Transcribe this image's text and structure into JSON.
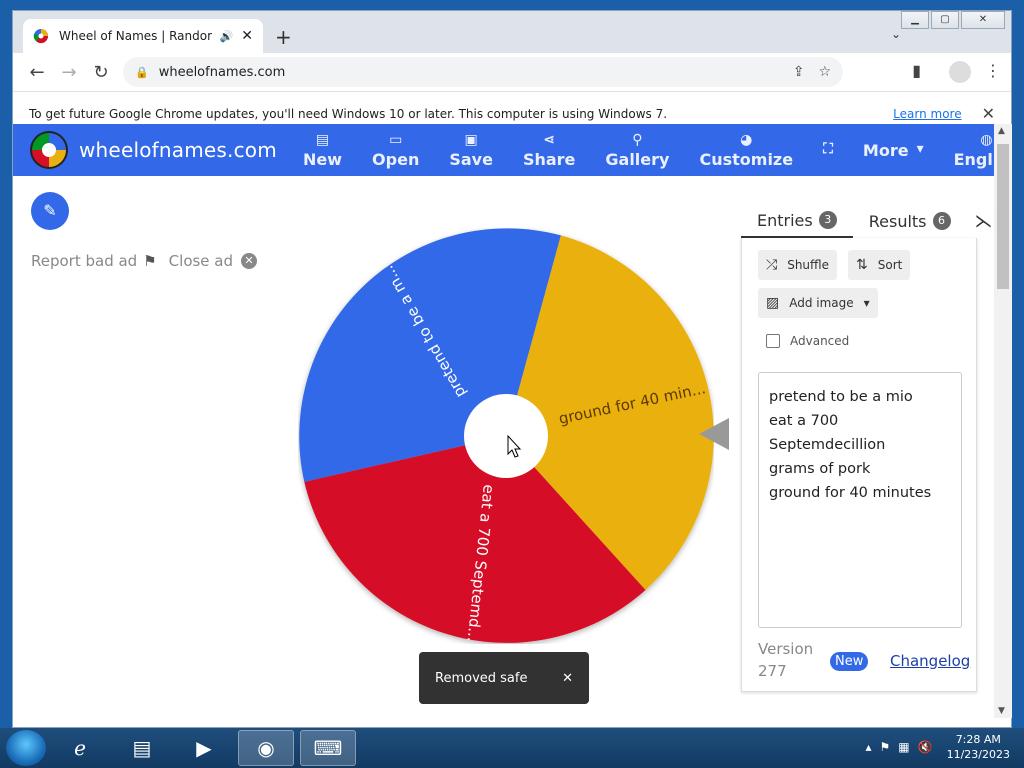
{
  "browser": {
    "tab_title": "Wheel of Names | Random n",
    "url": "wheelofnames.com",
    "infobar_text": "To get future Google Chrome updates, you'll need Windows 10 or later. This computer is using Windows 7.",
    "infobar_link": "Learn more"
  },
  "app": {
    "brand": "wheelofnames.com",
    "menu": [
      {
        "label": "New",
        "icon": "file-icon"
      },
      {
        "label": "Open",
        "icon": "folder-icon"
      },
      {
        "label": "Save",
        "icon": "save-icon"
      },
      {
        "label": "Share",
        "icon": "share-icon"
      },
      {
        "label": "Gallery",
        "icon": "search-icon"
      },
      {
        "label": "Customize",
        "icon": "palette-icon"
      },
      {
        "label": "",
        "icon": "fullscreen-icon"
      },
      {
        "label": "More",
        "icon": "caret-down-icon"
      },
      {
        "label": "English",
        "icon": "globe-icon"
      }
    ],
    "report_ad": "Report bad ad",
    "close_ad": "Close ad"
  },
  "wheel": {
    "slices": [
      {
        "label": "pretend to be a m...",
        "color": "#3369e8"
      },
      {
        "label": "ground for 40 min...",
        "color": "#eab011"
      },
      {
        "label": "eat a 700 Septemd...",
        "color": "#d50f25"
      }
    ]
  },
  "toast": {
    "text": "Removed safe",
    "close": "✕"
  },
  "sidebar": {
    "tab_entries": "Entries",
    "entries_count": "3",
    "tab_results": "Results",
    "results_count": "6",
    "shuffle": "Shuffle",
    "sort": "Sort",
    "add_image": "Add image",
    "advanced": "Advanced",
    "entries_lines": [
      "pretend to be a mio",
      "eat a 700 Septemdecillion",
      "grams of pork",
      "ground for 40 minutes"
    ],
    "version_label": "Version",
    "version_number": "277",
    "new_label": "New",
    "changelog": "Changelog"
  },
  "taskbar": {
    "time": "7:28 AM",
    "date": "11/23/2023"
  }
}
